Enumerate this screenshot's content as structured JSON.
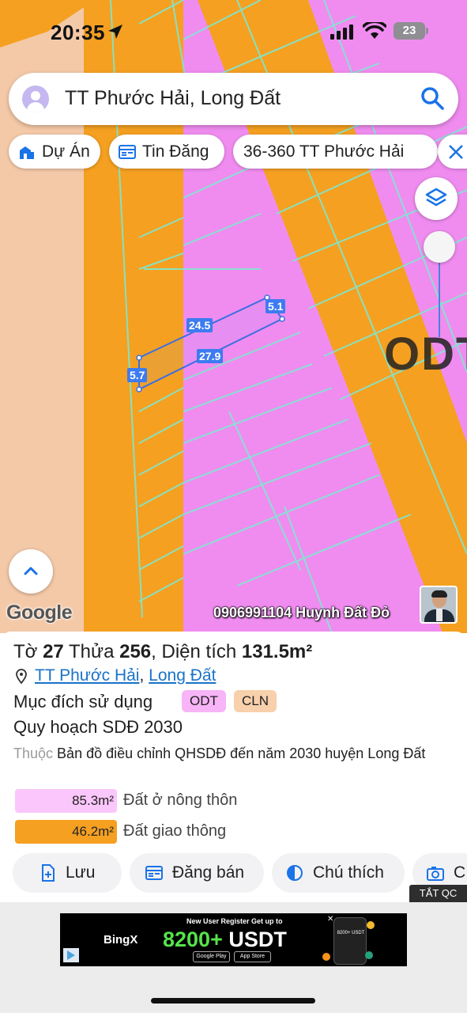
{
  "status_bar": {
    "time": "20:35",
    "battery": "23"
  },
  "search": {
    "query": "TT Phước Hải, Long Đất"
  },
  "chips": [
    {
      "label": "Dự Án",
      "icon": "project-icon"
    },
    {
      "label": "Tin Đăng",
      "icon": "listing-icon"
    },
    {
      "label": "36-360 TT Phước Hải",
      "icon": ""
    }
  ],
  "map": {
    "zone_label": "ODT",
    "parcel_edges": [
      "24.5",
      "5.1",
      "27.9",
      "5.7"
    ],
    "google_logo": "Google",
    "watermark": "0906991104 Huynh Đất Đỏ",
    "colors": {
      "residential_zone": "#f08cf0",
      "road_zone": "#f5a021",
      "perennial_zone": "#f4c9a8",
      "lines": "#7fe8d0"
    }
  },
  "parcel": {
    "title_prefix": "Tờ",
    "sheet_no": "27",
    "parcel_word": "Thửa",
    "parcel_no": "256",
    "area_label": ", Diện tích",
    "area": "131.5m²",
    "commune": "TT Phước Hải",
    "separator": ",",
    "district": "Long Đất",
    "usage_label": "Mục đích sử dụng",
    "usage_tags": [
      {
        "code": "ODT",
        "color": "#f7b4f7"
      },
      {
        "code": "CLN",
        "color": "#f8d0ac"
      }
    ],
    "plan_title": "Quy hoạch SDĐ 2030",
    "source_prefix": "Thuộc",
    "source_text": "Bản đồ điều chỉnh QHSDĐ đến năm 2030 huyện Long Đất",
    "areas": [
      {
        "value": "85.3m²",
        "label": "Đất ở nông thôn",
        "color": "#fbc6fb"
      },
      {
        "value": "46.2m²",
        "label": "Đất giao thông",
        "color": "#f5a021"
      }
    ]
  },
  "actions": [
    {
      "label": "Lưu",
      "icon": "save-icon"
    },
    {
      "label": "Đăng bán",
      "icon": "post-sale-icon"
    },
    {
      "label": "Chú thích",
      "icon": "legend-icon"
    },
    {
      "label": "C",
      "icon": "camera-icon"
    }
  ],
  "ad": {
    "close_label": "TẮT QC",
    "top_text": "New User Register Get up to",
    "brand": "BingX",
    "amount": "8200+",
    "currency": "USDT",
    "store_1": "Google Play",
    "store_2": "App Store",
    "phone_text": "8200+ USDT"
  }
}
